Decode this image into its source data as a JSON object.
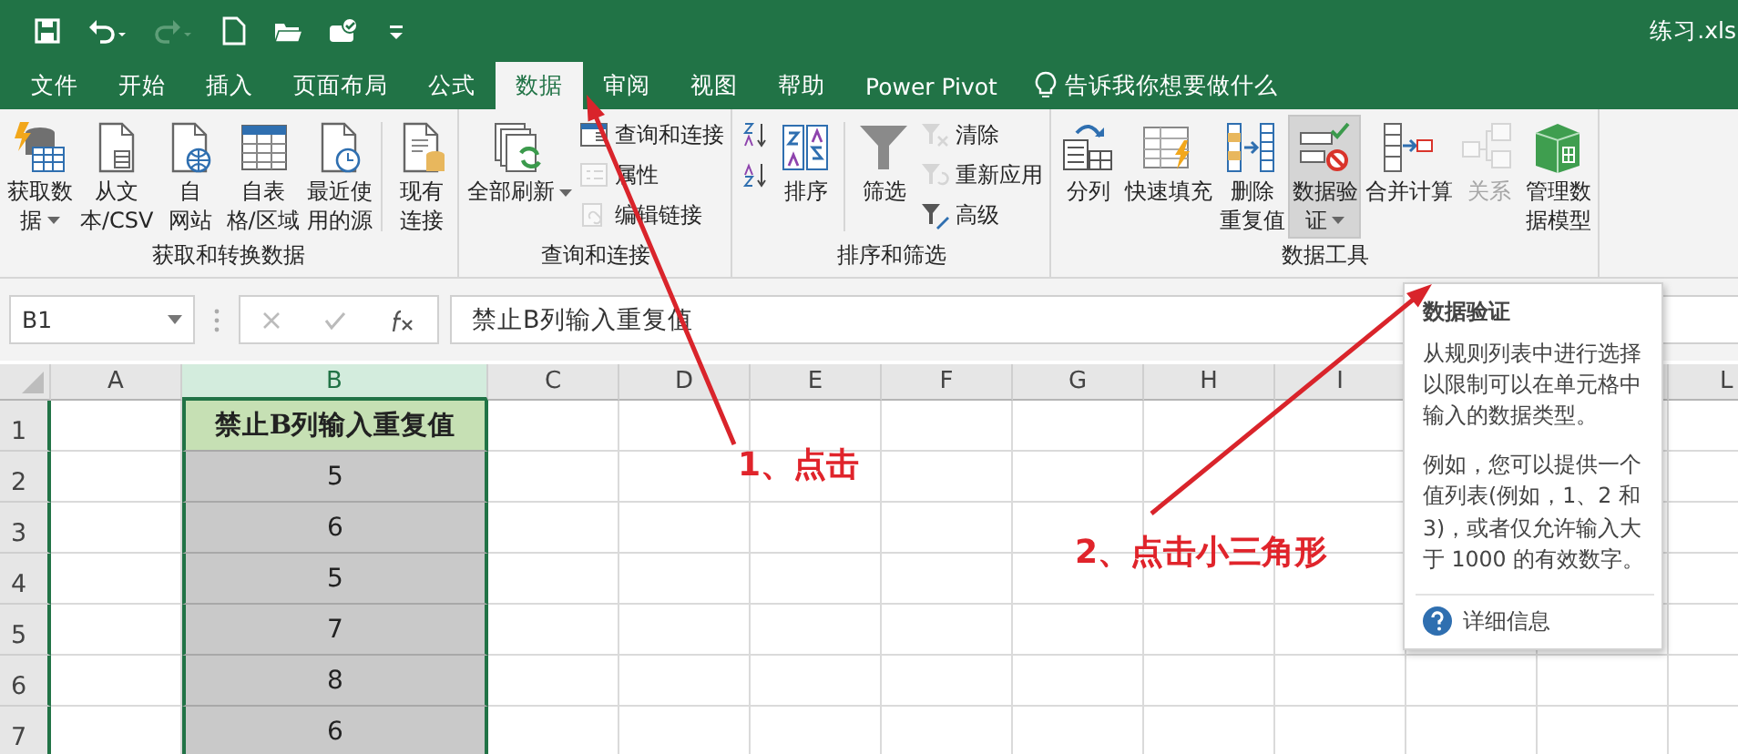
{
  "window": {
    "title": "练习.xls"
  },
  "quick_access": [
    {
      "kind": "save",
      "disabled": false
    },
    {
      "kind": "undo",
      "disabled": false
    },
    {
      "kind": "redo",
      "disabled": true
    },
    {
      "kind": "new",
      "disabled": false
    },
    {
      "kind": "open",
      "disabled": false
    },
    {
      "kind": "touch",
      "disabled": false
    },
    {
      "kind": "customize",
      "disabled": false
    }
  ],
  "tabs": [
    {
      "label": "文件",
      "selected": false
    },
    {
      "label": "开始",
      "selected": false
    },
    {
      "label": "插入",
      "selected": false
    },
    {
      "label": "页面布局",
      "selected": false
    },
    {
      "label": "公式",
      "selected": false
    },
    {
      "label": "数据",
      "selected": true
    },
    {
      "label": "审阅",
      "selected": false
    },
    {
      "label": "视图",
      "selected": false
    },
    {
      "label": "帮助",
      "selected": false
    },
    {
      "label": "Power Pivot",
      "selected": false
    }
  ],
  "tell_me": {
    "label": "告诉我你想要做什么"
  },
  "ribbon": {
    "groups": [
      {
        "label": "获取和转换数据",
        "items": [
          {
            "kind": "big",
            "label": "获取数据",
            "dropdown": true,
            "disabled": false,
            "highlighted": false
          },
          {
            "kind": "big",
            "label": "从文本/CSV",
            "dropdown": false,
            "disabled": false,
            "highlighted": false
          },
          {
            "kind": "big",
            "label": "自网站",
            "dropdown": false,
            "disabled": false,
            "highlighted": false
          },
          {
            "kind": "big",
            "label": "自表格/区域",
            "dropdown": false,
            "disabled": false,
            "highlighted": false
          },
          {
            "kind": "big",
            "label": "最近使用的源",
            "dropdown": false,
            "disabled": false,
            "highlighted": false
          },
          {
            "kind": "separator"
          },
          {
            "kind": "big",
            "label": "现有连接",
            "dropdown": false,
            "disabled": false,
            "highlighted": false
          }
        ]
      },
      {
        "label": "查询和连接",
        "items": [
          {
            "kind": "big",
            "label": "全部刷新",
            "dropdown": true,
            "disabled": false,
            "highlighted": false
          },
          {
            "kind": "stack",
            "items": [
              {
                "label": "查询和连接",
                "disabled": false
              },
              {
                "label": "属性",
                "disabled": true
              },
              {
                "label": "编辑链接",
                "disabled": true
              }
            ]
          }
        ]
      },
      {
        "label": "排序和筛选",
        "items": [
          {
            "kind": "stack",
            "items": [
              {
                "disabled": false
              },
              {
                "disabled": false
              }
            ]
          },
          {
            "kind": "big",
            "label": "排序",
            "dropdown": false,
            "disabled": false,
            "highlighted": false
          },
          {
            "kind": "separator"
          },
          {
            "kind": "big",
            "label": "筛选",
            "dropdown": false,
            "disabled": false,
            "highlighted": false
          },
          {
            "kind": "stack",
            "items": [
              {
                "label": "清除",
                "disabled": true
              },
              {
                "label": "重新应用",
                "disabled": true
              },
              {
                "label": "高级",
                "disabled": false
              }
            ]
          }
        ]
      },
      {
        "label": "数据工具",
        "items": [
          {
            "kind": "big",
            "label": "分列",
            "dropdown": false,
            "disabled": false,
            "highlighted": false
          },
          {
            "kind": "big",
            "label": "快速填充",
            "dropdown": false,
            "disabled": false,
            "highlighted": false
          },
          {
            "kind": "big",
            "label": "删除重复值",
            "dropdown": false,
            "disabled": false,
            "highlighted": false
          },
          {
            "kind": "big",
            "label": "数据验证",
            "dropdown": true,
            "disabled": false,
            "highlighted": true
          },
          {
            "kind": "big",
            "label": "合并计算",
            "dropdown": false,
            "disabled": false,
            "highlighted": false
          },
          {
            "kind": "big",
            "label": "关系",
            "dropdown": false,
            "disabled": true,
            "highlighted": false
          },
          {
            "kind": "big",
            "label": "管理数据模型",
            "dropdown": false,
            "disabled": false,
            "highlighted": false
          }
        ]
      }
    ]
  },
  "formula_bar": {
    "name_box": "B1",
    "formula": "禁止B列输入重复值"
  },
  "sheet": {
    "columns": [
      {
        "label": "A",
        "selected": false
      },
      {
        "label": "B",
        "selected": true
      },
      {
        "label": "C",
        "selected": false
      },
      {
        "label": "D",
        "selected": false
      },
      {
        "label": "E",
        "selected": false
      },
      {
        "label": "F",
        "selected": false
      },
      {
        "label": "G",
        "selected": false
      },
      {
        "label": "H",
        "selected": false
      },
      {
        "label": "I",
        "selected": false
      },
      {
        "label": "L",
        "selected": false
      }
    ],
    "rows": [
      {
        "number": "1",
        "b": "禁止B列输入重复值",
        "kind": "header"
      },
      {
        "number": "2",
        "b": "5",
        "kind": "value"
      },
      {
        "number": "3",
        "b": "6",
        "kind": "value"
      },
      {
        "number": "4",
        "b": "5",
        "kind": "value"
      },
      {
        "number": "5",
        "b": "7",
        "kind": "value"
      },
      {
        "number": "6",
        "b": "8",
        "kind": "value"
      },
      {
        "number": "7",
        "b": "6",
        "kind": "value"
      }
    ]
  },
  "tooltip": {
    "title": "数据验证",
    "paragraphs": [
      "从规则列表中进行选择以限制可以在单元格中输入的数据类型。",
      "例如，您可以提供一个值列表(例如，1、2 和 3)，或者仅允许输入大于 1000 的有效数字。"
    ],
    "link": "详细信息"
  },
  "annotations": [
    {
      "text": "1、点击"
    },
    {
      "text": "2、点击小三角形"
    }
  ]
}
